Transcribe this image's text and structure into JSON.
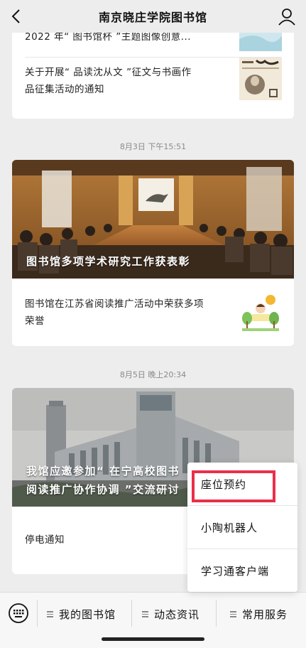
{
  "header": {
    "title": "南京晓庄学院图书馆"
  },
  "feed": {
    "card1": {
      "row1_text": "2022 年“ 图书馆杯 ”主题图像创意...",
      "row2_text_line1": "关于开展“ 品读沈从文 ”征文与书画作",
      "row2_text_line2": "品征集活动的通知"
    },
    "date2": "8月3日 下午15:51",
    "card2": {
      "hero_caption": "图书馆多项学术研究工作获表彰",
      "row_text_line1": "图书馆在江苏省阅读推广活动中荣获多项",
      "row_text_line2": "荣誉"
    },
    "date3": "8月5日 晚上20:34",
    "card3": {
      "hero_caption_line1": "我馆应邀参加“ 在宁高校图书",
      "hero_caption_line2": "阅读推广协作协调 ”交流研讨",
      "row_text": "停电通知"
    }
  },
  "popup": {
    "items": [
      "座位预约",
      "小陶机器人",
      "学习通客户端"
    ]
  },
  "bottombar": {
    "tabs": [
      "我的图书馆",
      "动态资讯",
      "常用服务"
    ]
  },
  "colors": {
    "background": "#ededed",
    "highlight": "#e8304a"
  }
}
